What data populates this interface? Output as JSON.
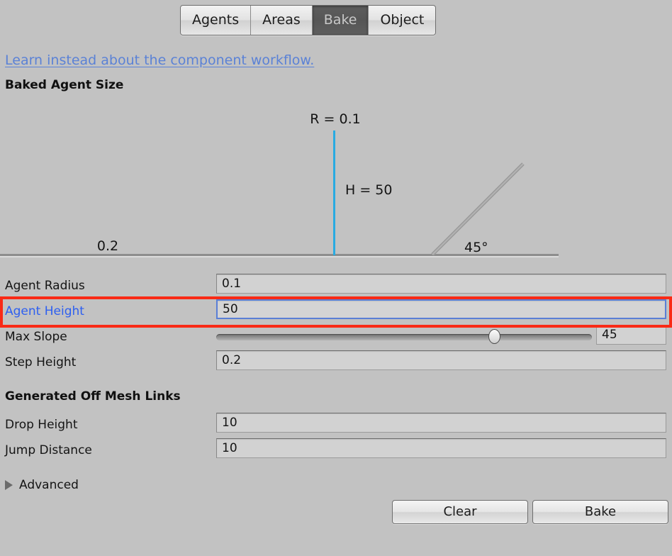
{
  "tabs": [
    {
      "label": "Agents",
      "selected": false
    },
    {
      "label": "Areas",
      "selected": false
    },
    {
      "label": "Bake",
      "selected": true
    },
    {
      "label": "Object",
      "selected": false
    }
  ],
  "doc_link": {
    "label": "Learn instead about the component workflow."
  },
  "sections": {
    "baked_agent_size": "Baked Agent Size",
    "generated_off_mesh_links": "Generated Off Mesh Links"
  },
  "diagram": {
    "radius_label": "R = 0.1",
    "height_label": "H = 50",
    "step_label": "0.2",
    "slope_label": "45°",
    "height_line_color": "#29abe2",
    "ground_color": "#8d8d8d",
    "slope_color": "#9a9a9a"
  },
  "properties": [
    {
      "label": "Agent Radius",
      "value": "0.1"
    },
    {
      "label": "Agent Height",
      "value": "50"
    },
    {
      "label": "Max Slope",
      "value": "45",
      "slider_percent": 74
    },
    {
      "label": "Step Height",
      "value": "0.2"
    }
  ],
  "off_mesh_links": [
    {
      "label": "Drop Height",
      "value": "10"
    },
    {
      "label": "Jump Distance",
      "value": "10"
    }
  ],
  "advanced": {
    "label": "Advanced",
    "expanded": false
  },
  "buttons": {
    "clear": "Clear",
    "bake": "Bake"
  },
  "highlight": {
    "target": "Agent Height",
    "box_color": "#f92a16",
    "focus_border_color": "#5a7fd6",
    "focus_label_color": "#2d5ff0"
  }
}
